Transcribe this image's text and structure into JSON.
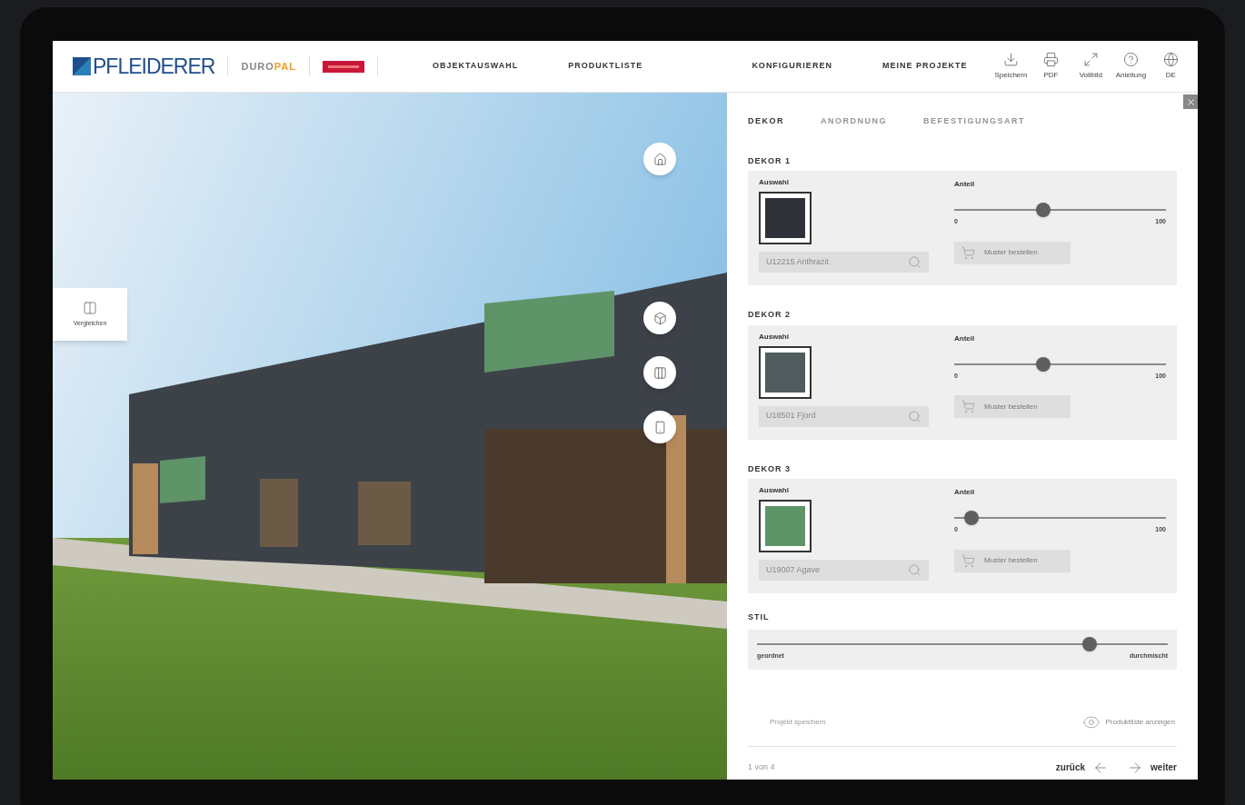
{
  "brand": {
    "name": "PFLEIDERER",
    "sub_brand": [
      "DURO",
      "PAL"
    ]
  },
  "nav": [
    "OBJEKTAUSWAHL",
    "PRODUKTLISTE",
    "KONFIGURIEREN",
    "MEINE PROJEKTE"
  ],
  "toolbar": [
    {
      "kind": "download",
      "label": "Speichern"
    },
    {
      "kind": "print",
      "label": "PDF"
    },
    {
      "kind": "fullscreen",
      "label": "Vollbild"
    },
    {
      "kind": "help",
      "label": "Anleitung"
    },
    {
      "kind": "language",
      "label": "DE"
    }
  ],
  "compare_button": {
    "label": "Vergleichen"
  },
  "view_buttons": [
    {
      "kind": "home"
    },
    {
      "kind": "cube"
    },
    {
      "kind": "panels"
    },
    {
      "kind": "mobile"
    }
  ],
  "panel": {
    "tabs": [
      {
        "label": "DEKOR",
        "selected": true
      },
      {
        "label": "ANORDNUNG",
        "selected": false
      },
      {
        "label": "BEFESTIGUNGSART",
        "selected": false
      }
    ],
    "decors": [
      {
        "title": "DEKOR 1",
        "selection_label": "Auswahl",
        "color": "#2f3138",
        "search_value": "U12215 Anthrazit",
        "share_label": "Anteil",
        "level": 0.42,
        "min": "0",
        "max": "100",
        "order_button": "Muster bestellen"
      },
      {
        "title": "DEKOR 2",
        "selection_label": "Auswahl",
        "color": "#4f5b5d",
        "search_value": "U18501 Fjord",
        "share_label": "Anteil",
        "level": 0.42,
        "min": "0",
        "max": "100",
        "order_button": "Muster bestellen"
      },
      {
        "title": "DEKOR 3",
        "selection_label": "Auswahl",
        "color": "#5e9468",
        "search_value": "U19007 Agave",
        "share_label": "Anteil",
        "level": 0.08,
        "min": "0",
        "max": "100",
        "order_button": "Muster bestellen"
      }
    ],
    "style": {
      "title": "STIL",
      "level": 0.81,
      "min_label": "geordnet",
      "max_label": "durchmischt"
    },
    "save_link": "Projekt speichern",
    "product_list_link": "Produktliste anzeigen",
    "pager": "1 von 4",
    "back": "zurück",
    "next": "weiter"
  }
}
